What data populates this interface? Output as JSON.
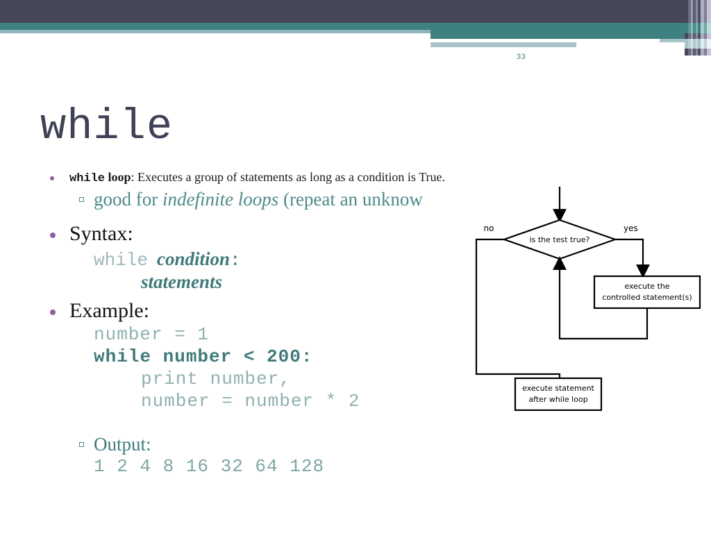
{
  "slide": {
    "page_number": "33",
    "title": "while",
    "colors": {
      "header_dark": "#454759",
      "header_teal": "#3f8080",
      "header_pale": "#a9c3c9",
      "accent_teal": "#3f7a7a",
      "bullet_purple": "#8e5fa0",
      "code_gray": "#8fb0b0",
      "title_slate": "#3f4156"
    }
  },
  "bullets": {
    "while_loop": {
      "keyword": "while",
      "bold_rest": " loop",
      "text": ": Executes a group of statements as long as a condition is True."
    },
    "good_for": {
      "prefix": "good for ",
      "italic": "indefinite loops",
      "suffix": " (repeat an unknow"
    },
    "syntax": {
      "heading": "Syntax:",
      "keyword": "while",
      "condition": "condition",
      "colon": ":",
      "statements": "statements"
    },
    "example": {
      "heading": "Example:",
      "code_line_1": "number = 1",
      "code_line_2": "while number < 200:",
      "code_line_3": "print number,",
      "code_line_4": "number = number * 2"
    },
    "output": {
      "heading": "Output:",
      "values": "1 2 4 8 16 32 64 128"
    }
  },
  "flowchart": {
    "decision": "is the test true?",
    "label_no": "no",
    "label_yes": "yes",
    "box_execute_line1": "execute the",
    "box_execute_line2": "controlled statement(s)",
    "box_after_line1": "execute statement",
    "box_after_line2": "after while loop"
  }
}
